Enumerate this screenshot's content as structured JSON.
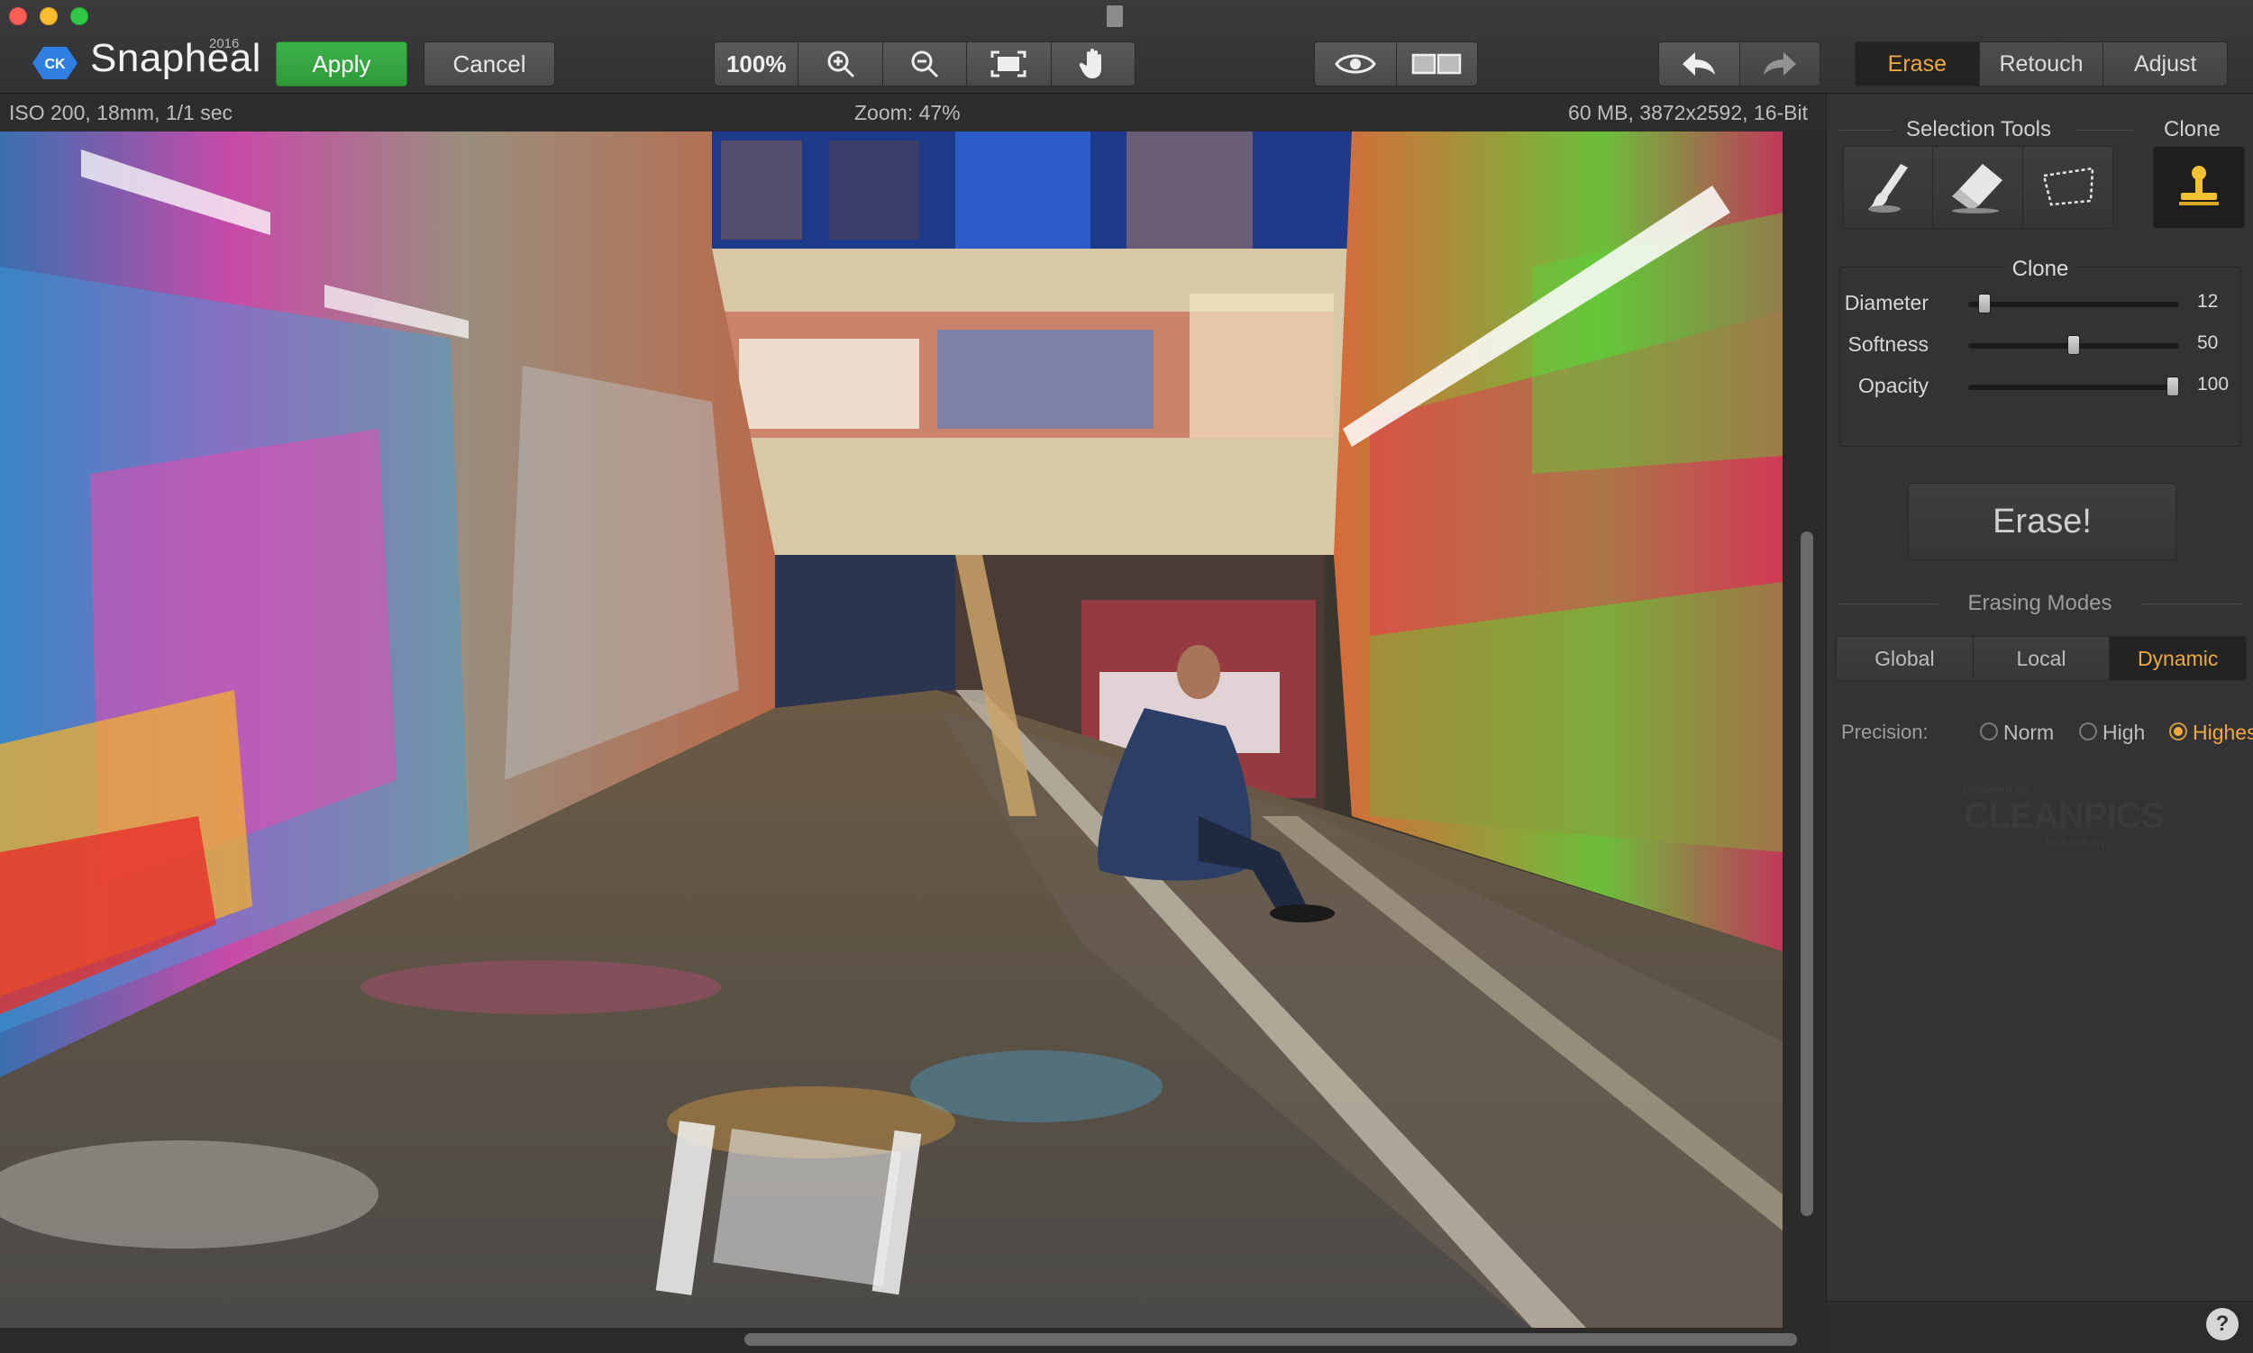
{
  "app": {
    "name": "Snapheal",
    "year": "2016",
    "badge": "CK"
  },
  "toolbar": {
    "apply_label": "Apply",
    "cancel_label": "Cancel",
    "zoom_value": "100%"
  },
  "mode_tabs": [
    {
      "label": "Erase",
      "active": true
    },
    {
      "label": "Retouch",
      "active": false
    },
    {
      "label": "Adjust",
      "active": false
    }
  ],
  "info": {
    "exif": "ISO 200, 18mm, 1/1 sec",
    "zoom": "Zoom: 47%",
    "file": "60 MB, 3872x2592, 16-Bit"
  },
  "panel": {
    "selection_tools_title": "Selection Tools",
    "clone_title": "Clone",
    "clone_box_title": "Clone",
    "sliders": [
      {
        "label": "Diameter",
        "value": "12",
        "level": 0.05
      },
      {
        "label": "Softness",
        "value": "50",
        "level": 0.5
      },
      {
        "label": "Opacity",
        "value": "100",
        "level": 1.0
      }
    ],
    "erase_button": "Erase!",
    "erasing_modes_title": "Erasing Modes",
    "erasing_modes": [
      {
        "label": "Global",
        "active": false
      },
      {
        "label": "Local",
        "active": false
      },
      {
        "label": "Dynamic",
        "active": true
      }
    ],
    "precision_label": "Precision:",
    "precision_options": [
      {
        "label": "Norm",
        "selected": false
      },
      {
        "label": "High",
        "selected": false
      },
      {
        "label": "Highest",
        "selected": true
      }
    ],
    "powered_by": "powered by",
    "cleanpics": "CLEANPICS",
    "technology": "technology",
    "help": "?"
  },
  "colors": {
    "accent": "#f0a93c",
    "apply_green": "#3db24a"
  }
}
